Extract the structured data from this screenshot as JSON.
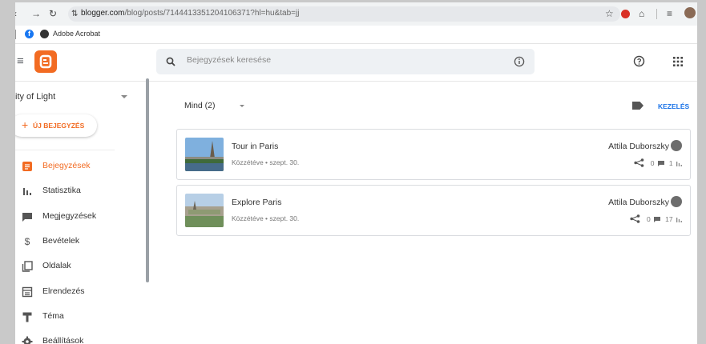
{
  "browser": {
    "url_host": "blogger.com",
    "url_rest": "/blog/posts/7144413351204106371?hl=hu&tab=jj",
    "bookmarks": [
      "Adobe Acrobat"
    ]
  },
  "header": {
    "search_placeholder": "Bejegyzések keresése"
  },
  "sidebar": {
    "blog_title": "ity of Light",
    "new_post_label": "ÚJ BEJEGYZÉS",
    "items": [
      {
        "label": "Bejegyzések",
        "icon": "posts-icon"
      },
      {
        "label": "Statisztika",
        "icon": "stats-icon"
      },
      {
        "label": "Megjegyzések",
        "icon": "comments-icon"
      },
      {
        "label": "Bevételek",
        "icon": "dollar-icon"
      },
      {
        "label": "Oldalak",
        "icon": "pages-icon"
      },
      {
        "label": "Elrendezés",
        "icon": "layout-icon"
      },
      {
        "label": "Téma",
        "icon": "theme-icon"
      },
      {
        "label": "Beállítások",
        "icon": "gear-icon"
      }
    ]
  },
  "main": {
    "filter_label": "Mind (2)",
    "manage_label": "KEZELÉS",
    "posts": [
      {
        "title": "Tour in Paris",
        "meta": "Közzétéve • szept. 30.",
        "author": "Attila Duborszky",
        "comments": "0",
        "views": "1"
      },
      {
        "title": "Explore Paris",
        "meta": "Közzétéve • szept. 30.",
        "author": "Attila Duborszky",
        "comments": "0",
        "views": "17"
      }
    ]
  },
  "colors": {
    "accent": "#f26b22",
    "manage": "#1a73e8"
  }
}
